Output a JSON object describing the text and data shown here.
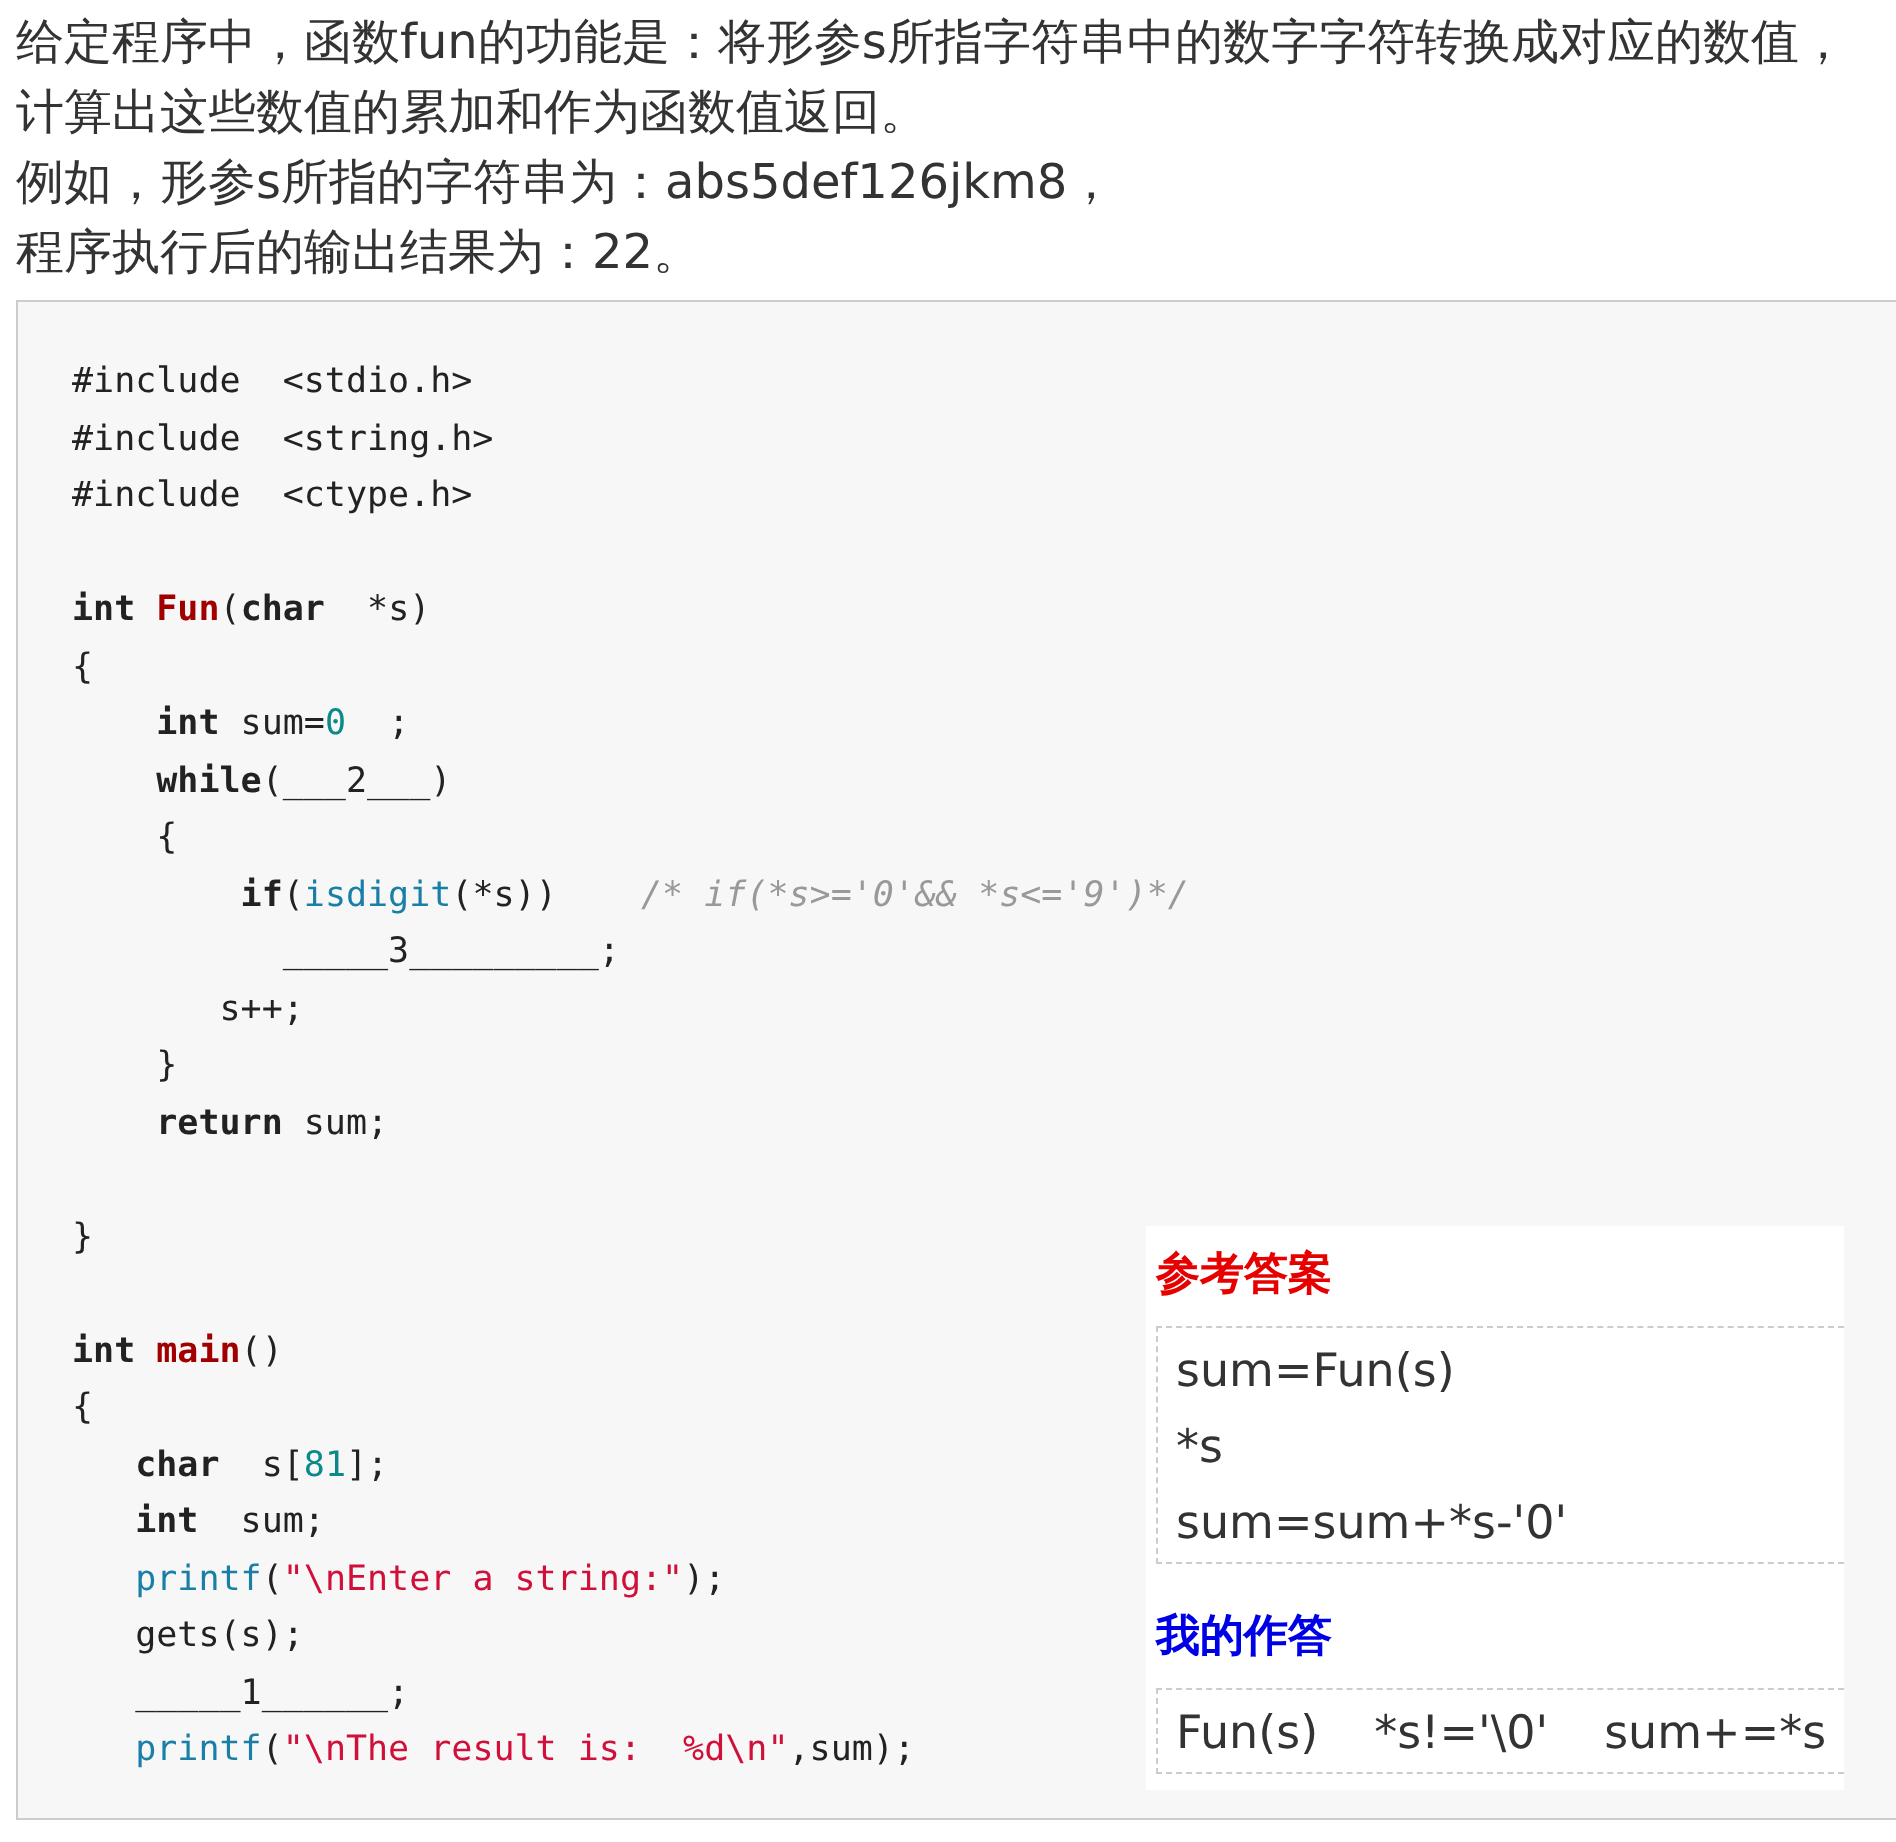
{
  "question": [
    "给定程序中，函数fun的功能是：将形参s所指字符串中的数字字符转换成对应的数值，",
    "计算出这些数值的累加和作为函数值返回。",
    "例如，形参s所指的字符串为：abs5def126jkm8，",
    "程序执行后的输出结果为：22。"
  ],
  "code": [
    {
      "kind": "code",
      "tokens": [
        {
          "text": "#include  <stdio.h>",
          "kind": "plain"
        }
      ]
    },
    {
      "kind": "code",
      "tokens": [
        {
          "text": "#include  <string.h>",
          "kind": "plain"
        }
      ]
    },
    {
      "kind": "code",
      "tokens": [
        {
          "text": "#include  <ctype.h>",
          "kind": "plain"
        }
      ]
    },
    {
      "kind": "blank"
    },
    {
      "kind": "code",
      "tokens": [
        {
          "text": "int",
          "kind": "keyword"
        },
        {
          "text": " Fun",
          "kind": "func"
        },
        {
          "text": "(",
          "kind": "plain"
        },
        {
          "text": "char",
          "kind": "keyword"
        },
        {
          "text": "  *s)",
          "kind": "plain"
        }
      ]
    },
    {
      "kind": "code",
      "tokens": [
        {
          "text": "{",
          "kind": "plain"
        }
      ]
    },
    {
      "kind": "code",
      "tokens": [
        {
          "text": "    int",
          "kind": "keyword"
        },
        {
          "text": " sum=",
          "kind": "plain"
        },
        {
          "text": "0",
          "kind": "number"
        },
        {
          "text": "  ;",
          "kind": "plain"
        }
      ]
    },
    {
      "kind": "code",
      "tokens": [
        {
          "text": "    while",
          "kind": "keyword"
        },
        {
          "text": "(___2___)",
          "kind": "plain"
        }
      ]
    },
    {
      "kind": "code",
      "tokens": [
        {
          "text": "    {",
          "kind": "plain"
        }
      ]
    },
    {
      "kind": "code",
      "tokens": [
        {
          "text": "        if",
          "kind": "keyword"
        },
        {
          "text": "(",
          "kind": "plain"
        },
        {
          "text": "isdigit",
          "kind": "builtin"
        },
        {
          "text": "(*s))    ",
          "kind": "plain"
        },
        {
          "text": "/* if(*s>='0'&& *s<='9')*/",
          "kind": "comment"
        }
      ]
    },
    {
      "kind": "code",
      "tokens": [
        {
          "text": "          _____3_________;",
          "kind": "plain"
        }
      ]
    },
    {
      "kind": "code",
      "tokens": [
        {
          "text": "       s++;",
          "kind": "plain"
        }
      ]
    },
    {
      "kind": "code",
      "tokens": [
        {
          "text": "    }",
          "kind": "plain"
        }
      ]
    },
    {
      "kind": "code",
      "tokens": [
        {
          "text": "    return",
          "kind": "keyword"
        },
        {
          "text": " sum;",
          "kind": "plain"
        }
      ]
    },
    {
      "kind": "blank"
    },
    {
      "kind": "code",
      "tokens": [
        {
          "text": "}",
          "kind": "plain"
        }
      ]
    },
    {
      "kind": "blank"
    },
    {
      "kind": "code",
      "tokens": [
        {
          "text": "int",
          "kind": "keyword"
        },
        {
          "text": " main",
          "kind": "func"
        },
        {
          "text": "()",
          "kind": "plain"
        }
      ]
    },
    {
      "kind": "code",
      "tokens": [
        {
          "text": "{",
          "kind": "plain"
        }
      ]
    },
    {
      "kind": "code",
      "tokens": [
        {
          "text": "   char",
          "kind": "keyword"
        },
        {
          "text": "  s[",
          "kind": "plain"
        },
        {
          "text": "81",
          "kind": "number"
        },
        {
          "text": "];",
          "kind": "plain"
        }
      ]
    },
    {
      "kind": "code",
      "tokens": [
        {
          "text": "   int",
          "kind": "keyword"
        },
        {
          "text": "  sum;",
          "kind": "plain"
        }
      ]
    },
    {
      "kind": "code",
      "tokens": [
        {
          "text": "   printf",
          "kind": "builtin"
        },
        {
          "text": "(",
          "kind": "plain"
        },
        {
          "text": "\"\\nEnter a string:\"",
          "kind": "string"
        },
        {
          "text": ");",
          "kind": "plain"
        }
      ]
    },
    {
      "kind": "code",
      "tokens": [
        {
          "text": "   gets(s);",
          "kind": "plain"
        }
      ]
    },
    {
      "kind": "code",
      "tokens": [
        {
          "text": "   _____1______;",
          "kind": "plain"
        }
      ]
    },
    {
      "kind": "code",
      "tokens": [
        {
          "text": "   printf",
          "kind": "builtin"
        },
        {
          "text": "(",
          "kind": "plain"
        },
        {
          "text": "\"\\nThe result is:  %d\\n\"",
          "kind": "string"
        },
        {
          "text": ",sum);",
          "kind": "plain"
        }
      ]
    }
  ],
  "reference_answer": {
    "title": "参考答案",
    "lines": [
      "sum=Fun(s)",
      "*s",
      "sum=sum+*s-'0'"
    ]
  },
  "my_answer": {
    "title": "我的作答",
    "answers": [
      "Fun(s)",
      "*s!='\\0'",
      "sum+=*s"
    ]
  }
}
